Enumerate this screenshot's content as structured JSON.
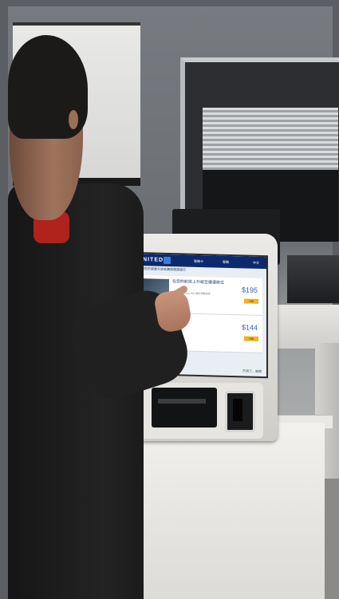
{
  "scene": {
    "kiosk_screen": {
      "logo": "UNITED",
      "header_items": [
        "登機卡",
        "登機",
        "中文"
      ],
      "subtitle": "根據您的需要升級或購買優選座位",
      "offers": [
        {
          "title": "在您的航班上升級至優選座位",
          "description": "United Economy Plus 額外伸展空間",
          "price": "$195",
          "button": "升級"
        },
        {
          "title": "",
          "description": "",
          "price": "$144",
          "button": "升級"
        }
      ],
      "footer": "不用了，謝謝"
    },
    "colors": {
      "screen_header": "#0b2a6e",
      "accent_button": "#f0b323",
      "price": "#2b66b8"
    }
  }
}
